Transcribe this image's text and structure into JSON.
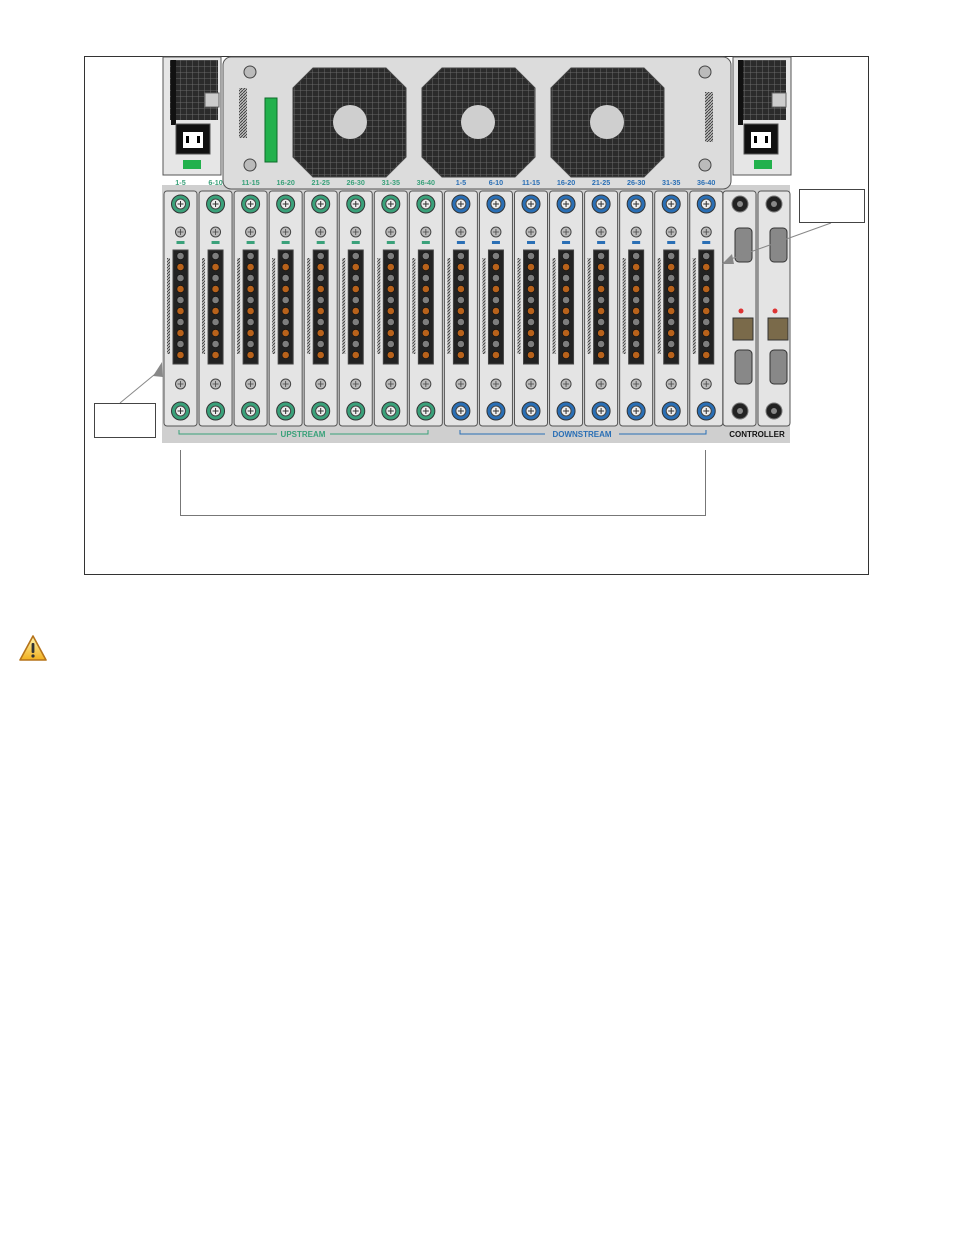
{
  "colors": {
    "upstream": "#3aa17a",
    "downstream": "#2a6fb5",
    "panel": "#d9d9d9",
    "power_green": "#22b14c"
  },
  "upstream_ranges": [
    "1-5",
    "6-10",
    "11-15",
    "16-20",
    "21-25",
    "26-30",
    "31-35",
    "36-40"
  ],
  "downstream_ranges": [
    "1-5",
    "6-10",
    "11-15",
    "16-20",
    "21-25",
    "26-30",
    "31-35",
    "36-40"
  ],
  "section_labels": {
    "upstream": "UPSTREAM",
    "downstream": "DOWNSTREAM",
    "controller": "CONTROLLER"
  },
  "icons": {
    "warning": "warning-triangle-icon"
  }
}
